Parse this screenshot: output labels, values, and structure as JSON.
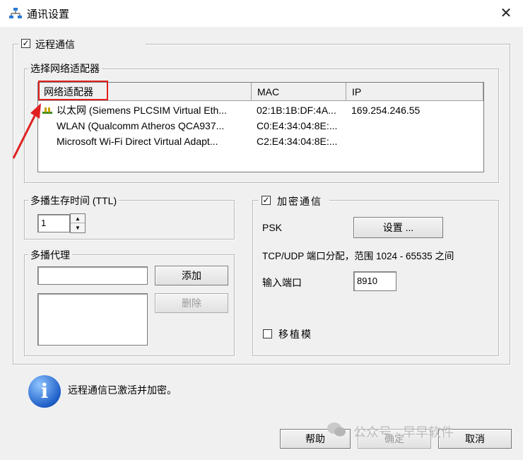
{
  "window": {
    "title": "通讯设置",
    "close_glyph": "✕"
  },
  "remote": {
    "label": "远程通信",
    "checked": "✓"
  },
  "adapter_group": {
    "legend": "选择网络适配器",
    "columns": [
      "网络适配器",
      "MAC",
      "IP"
    ],
    "rows": [
      {
        "name": "以太网 (Siemens PLCSIM Virtual Eth...",
        "mac": "02:1B:1B:DF:4A...",
        "ip": "169.254.246.55"
      },
      {
        "name": "WLAN (Qualcomm Atheros QCA937...",
        "mac": "C0:E4:34:04:8E:...",
        "ip": ""
      },
      {
        "name": "Microsoft Wi-Fi Direct Virtual Adapt...",
        "mac": "C2:E4:34:04:8E:...",
        "ip": ""
      }
    ]
  },
  "ttl_group": {
    "legend": "多播生存时间 (TTL)",
    "value": "1"
  },
  "proxy_group": {
    "legend": "多播代理",
    "add_label": "添加",
    "delete_label": "删除"
  },
  "encrypt_group": {
    "legend": "加密通信",
    "checked": "✓",
    "psk_label": "PSK",
    "settings_label": "设置 ...",
    "port_range_text": "TCP/UDP 端口分配，范围 1024 - 65535 之间",
    "input_port_label": "输入端口",
    "port_value": "8910",
    "transplant_label": "移植模"
  },
  "status": {
    "icon": "info-icon",
    "text": "远程通信已激活并加密。"
  },
  "footer": {
    "help_label": "帮助",
    "ok_label": "确定",
    "cancel_label": "取消"
  },
  "watermark": {
    "text": "公众号 · 早早软件"
  },
  "colors": {
    "annotation_red": "#e02020",
    "info_blue": "#1f5fc8"
  }
}
